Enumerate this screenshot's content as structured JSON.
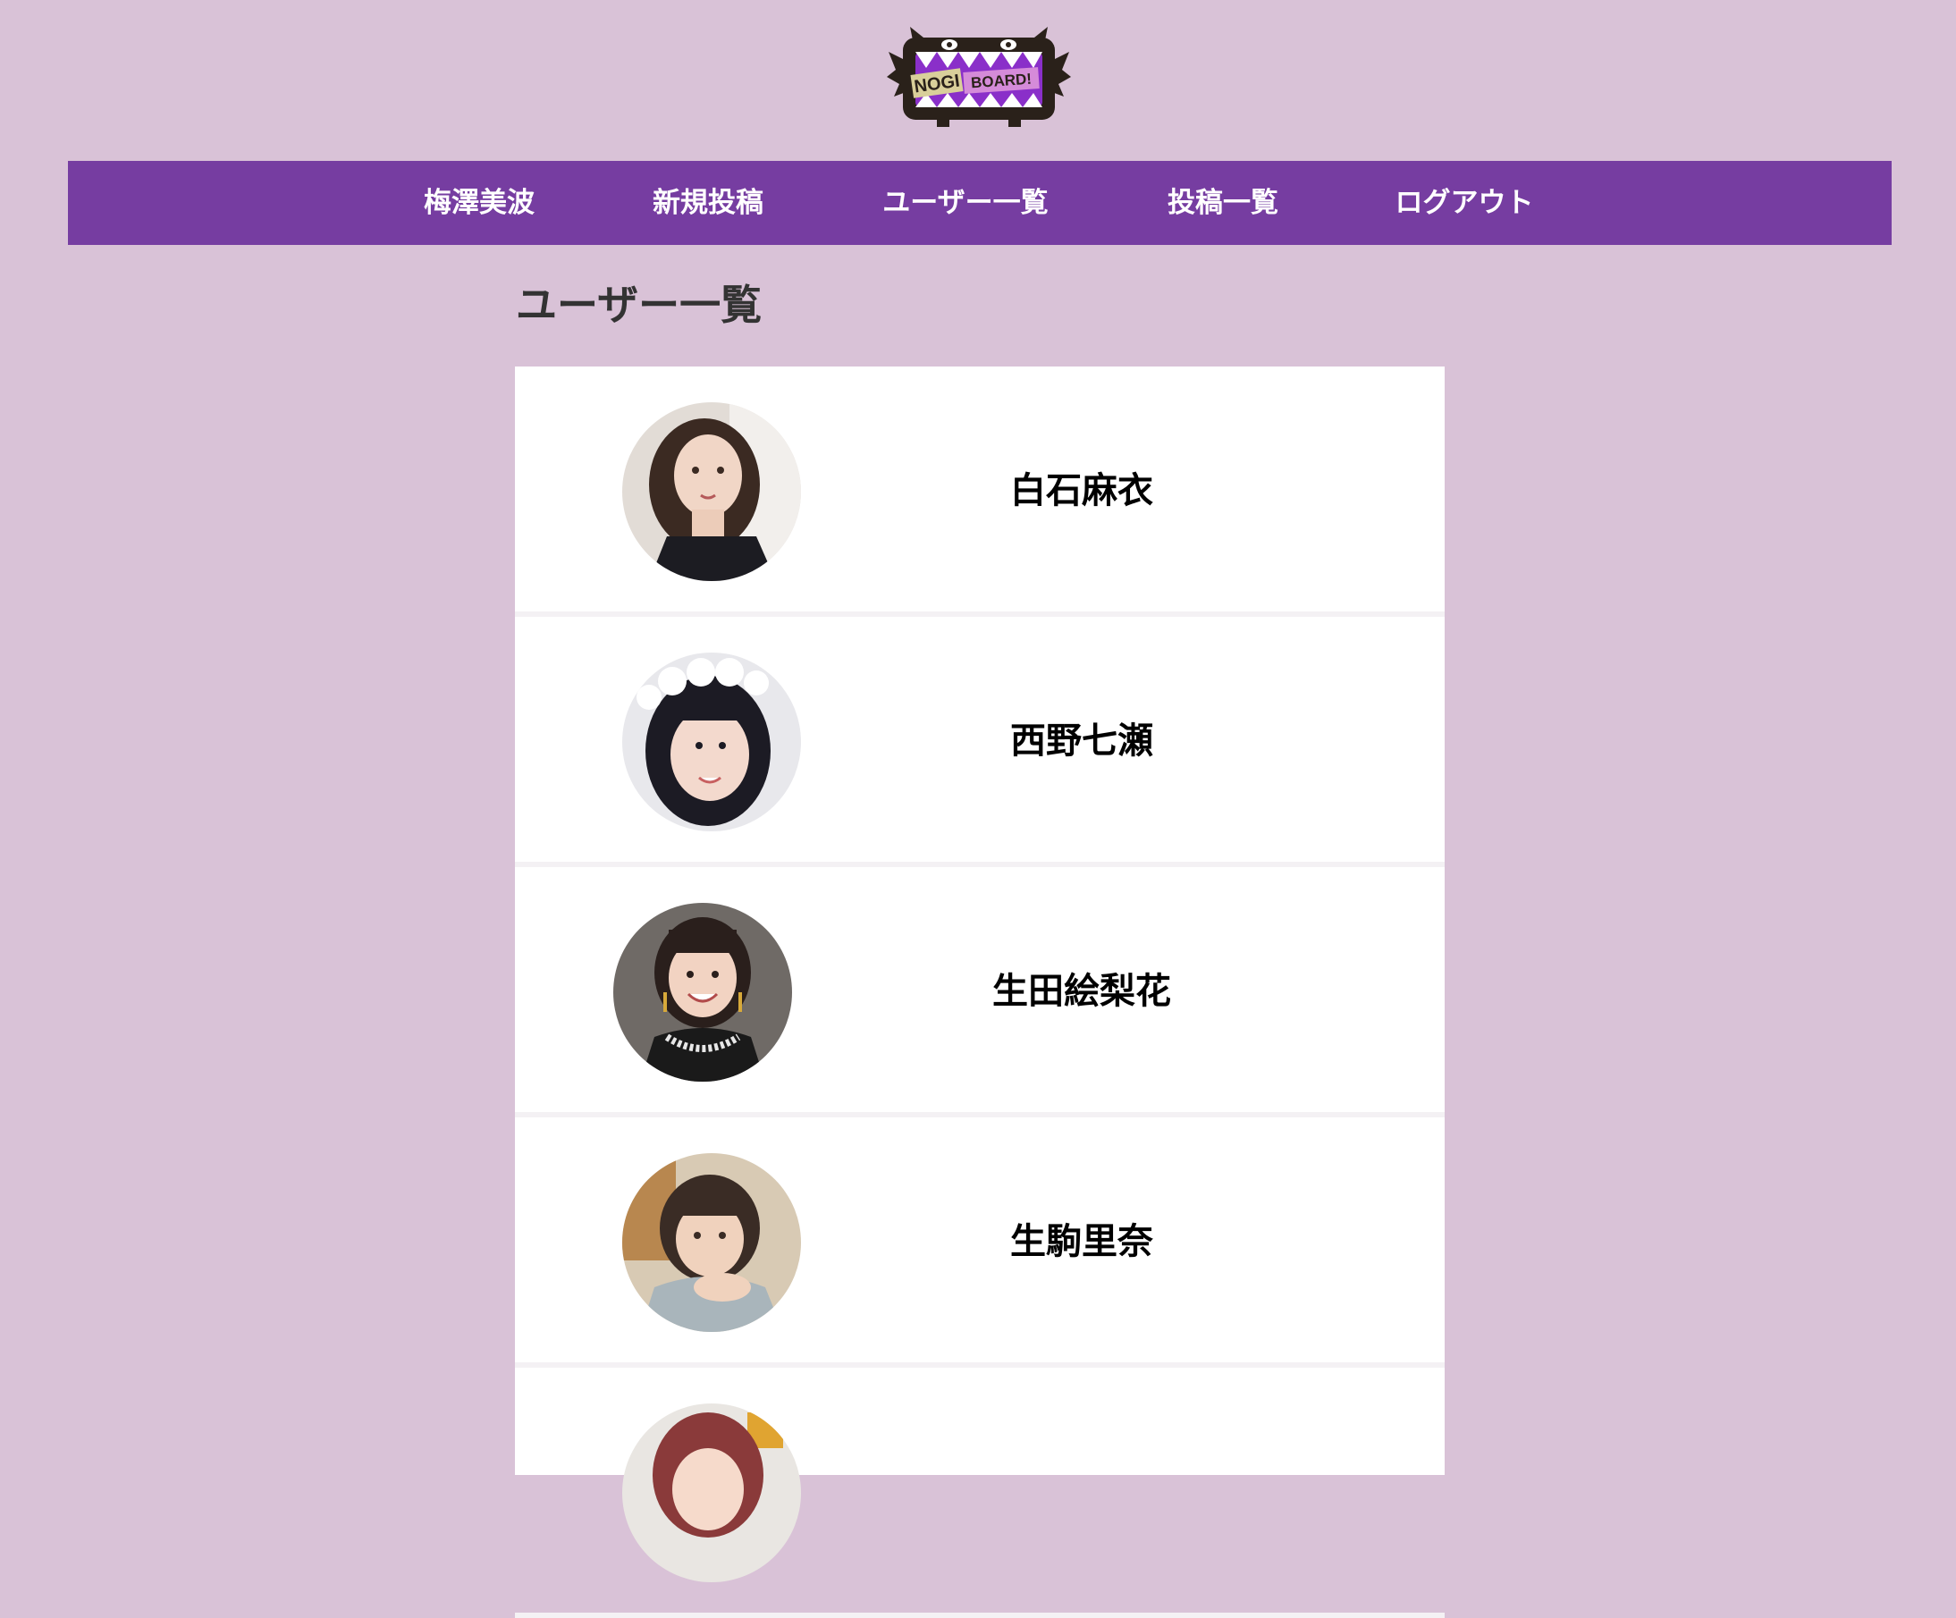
{
  "header": {
    "logo": {
      "icon": "monster-logo-icon",
      "text_part1": "NOGI",
      "text_part2": "BOARD!"
    }
  },
  "nav": {
    "items": [
      {
        "label": "梅澤美波"
      },
      {
        "label": "新規投稿"
      },
      {
        "label": "ユーザー一覧"
      },
      {
        "label": "投稿一覧"
      },
      {
        "label": "ログアウト"
      }
    ]
  },
  "main": {
    "title": "ユーザー一覧",
    "users": [
      {
        "name": "白石麻衣",
        "avatar": "avatar-photo-icon"
      },
      {
        "name": "西野七瀬",
        "avatar": "avatar-photo-icon"
      },
      {
        "name": "生田絵梨花",
        "avatar": "avatar-photo-icon"
      },
      {
        "name": "生駒里奈",
        "avatar": "avatar-photo-icon"
      },
      {
        "name": "",
        "avatar": "avatar-photo-icon"
      }
    ]
  },
  "colors": {
    "page_background": "#d9c2d7",
    "nav_background": "#763da1",
    "nav_text": "#ffffff",
    "card_background": "#ffffff",
    "title_text": "#333333",
    "name_text": "#000000"
  }
}
